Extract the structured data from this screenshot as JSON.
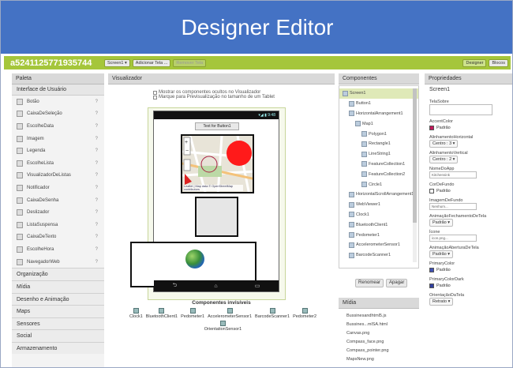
{
  "slide_title": "Designer Editor",
  "topbar": {
    "project": "a5241125771935744",
    "screen_btn": "Screen1 ▾",
    "add_screen": "Adicionar Tela ...",
    "remove_screen": "Remover Tela",
    "designer": "Designer",
    "blocks": "Blocos"
  },
  "palette": {
    "title": "Paleta",
    "section": "Interface de Usuário",
    "items": [
      "Botão",
      "CaixaDeSeleção",
      "EscolheData",
      "Imagem",
      "Legenda",
      "EscolheLista",
      "VisualizadorDeListas",
      "Notificador",
      "CaixaDeSenha",
      "Deslizador",
      "ListaSuspensa",
      "CaixaDeTexto",
      "EscolheHora",
      "NavegadorWeb"
    ],
    "categories": [
      "Organização",
      "Mídia",
      "Desenho e Animação",
      "Maps",
      "Sensores",
      "Social",
      "Armazenamento"
    ]
  },
  "viewer": {
    "title": "Visualizador",
    "check1": "Mostrar os componentes ocultos no Visualizador",
    "check2": "Marque para Previsualização no tamanho de um Tablet",
    "time": "9:48",
    "button_text": "Text for Button1",
    "map_credit": "Leaflet | Map data © OpenStreetMap contributors",
    "invisible_title": "Componentes invisíveis",
    "invisible": [
      "Clock1",
      "BluetoothClient1",
      "Pedometer1",
      "AccelerometerSensor1",
      "BarcodeScanner1",
      "Pedometer2",
      "OrientationSensor1"
    ]
  },
  "components": {
    "title": "Componentes",
    "tree": [
      "Screen1",
      "Button1",
      "HorizontalArrangement1",
      "Map1",
      "Polygon1",
      "Rectangle1",
      "LineString1",
      "FeatureCollection1",
      "FeatureCollection2",
      "Circle1",
      "HorizontalScrollArrangement1",
      "WebViewer1",
      "Clock1",
      "BluetoothClient1",
      "Pedometer1",
      "AccelerometerSensor1",
      "BarcodeScanner1"
    ],
    "rename": "Renomear",
    "delete": "Apagar"
  },
  "media": {
    "title": "Mídia",
    "files": [
      "Bussinesandhtml5.js",
      "Bussines...mlSA.html",
      "Canvas.png",
      "Compass_face.png",
      "Compass_pointer.png",
      "MapsNew.png"
    ]
  },
  "properties": {
    "title": "Propriedades",
    "screen": "Screen1",
    "items": [
      {
        "label": "TelaSobre",
        "value": "",
        "kind": "textarea"
      },
      {
        "label": "AccentColor",
        "value": "Padrão",
        "kind": "color",
        "color": "#c2185b"
      },
      {
        "label": "AlinhamentoHorizontal",
        "value": "Centro : 3 ▾",
        "kind": "select"
      },
      {
        "label": "AlinhamentoVertical",
        "value": "Centro : 2 ▾",
        "kind": "select"
      },
      {
        "label": "NomeDoApp",
        "value": "Kitchensink",
        "kind": "input"
      },
      {
        "label": "CorDeFundo",
        "value": "Padrão",
        "kind": "color",
        "color": "#ffffff"
      },
      {
        "label": "ImagemDeFundo",
        "value": "Nenhum...",
        "kind": "input"
      },
      {
        "label": "AnimaçãoFechamentoDeTela",
        "value": "Padrão ▾",
        "kind": "select"
      },
      {
        "label": "Ícone",
        "value": "icon.png...",
        "kind": "input"
      },
      {
        "label": "AnimaçãoAberturaDeTela",
        "value": "Padrão ▾",
        "kind": "select"
      },
      {
        "label": "PrimaryColor",
        "value": "Padrão",
        "kind": "color",
        "color": "#3f51b5"
      },
      {
        "label": "PrimaryColorDark",
        "value": "Padrão",
        "kind": "color",
        "color": "#303f9f"
      },
      {
        "label": "OrientaçãoDaTela",
        "value": "Retrato ▾",
        "kind": "select"
      }
    ]
  }
}
